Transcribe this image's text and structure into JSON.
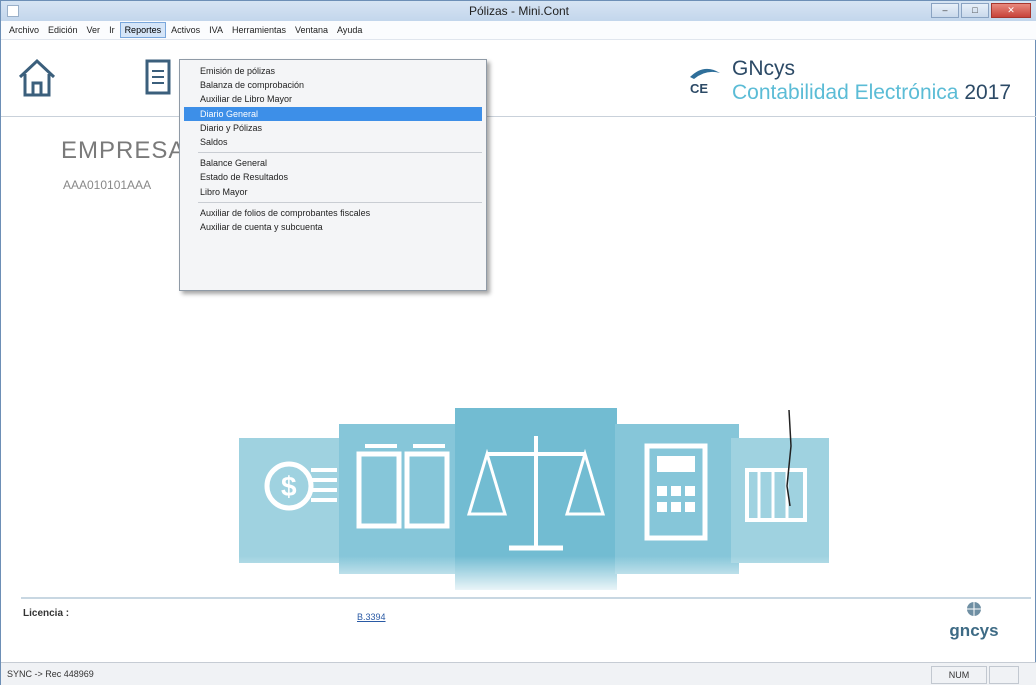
{
  "window": {
    "title": "Pólizas - Mini.Cont"
  },
  "menubar": {
    "items": [
      "Archivo",
      "Edición",
      "Ver",
      "Ir",
      "Reportes",
      "Activos",
      "IVA",
      "Herramientas",
      "Ventana",
      "Ayuda"
    ],
    "active": "Reportes"
  },
  "reportes_menu": {
    "group1": [
      "Emisión de pólizas",
      "Balanza de comprobación",
      "Auxiliar de Libro Mayor",
      "Diario General",
      "Diario y Pólizas",
      "Saldos"
    ],
    "group2": [
      "Balance General",
      "Estado de Resultados",
      "Libro Mayor"
    ],
    "group3": [
      "Auxiliar de folios de comprobantes fiscales",
      "Auxiliar de cuenta y subcuenta"
    ],
    "selected": "Diario General"
  },
  "brand": {
    "mark": "CE",
    "name": "GNcys",
    "subtitle": "Contabilidad Electrónica",
    "year": "2017"
  },
  "company": {
    "name": "EMPRESA",
    "rfc": "AAA010101AAA"
  },
  "footer": {
    "licence_label": "Licencia :",
    "licence_value": "B.3394",
    "logo_text": "gncys"
  },
  "statusbar": {
    "text": "SYNC -> Rec 448969",
    "num": "NUM"
  },
  "icons": [
    "home-icon",
    "document-icon",
    "money-icon",
    "files-icon",
    "scale-icon",
    "calculator-icon",
    "building-icon"
  ],
  "colors": {
    "accent": "#5bbcd6",
    "menu_selected": "#3d8fe8",
    "hero_tile": "#7ec3d6"
  }
}
